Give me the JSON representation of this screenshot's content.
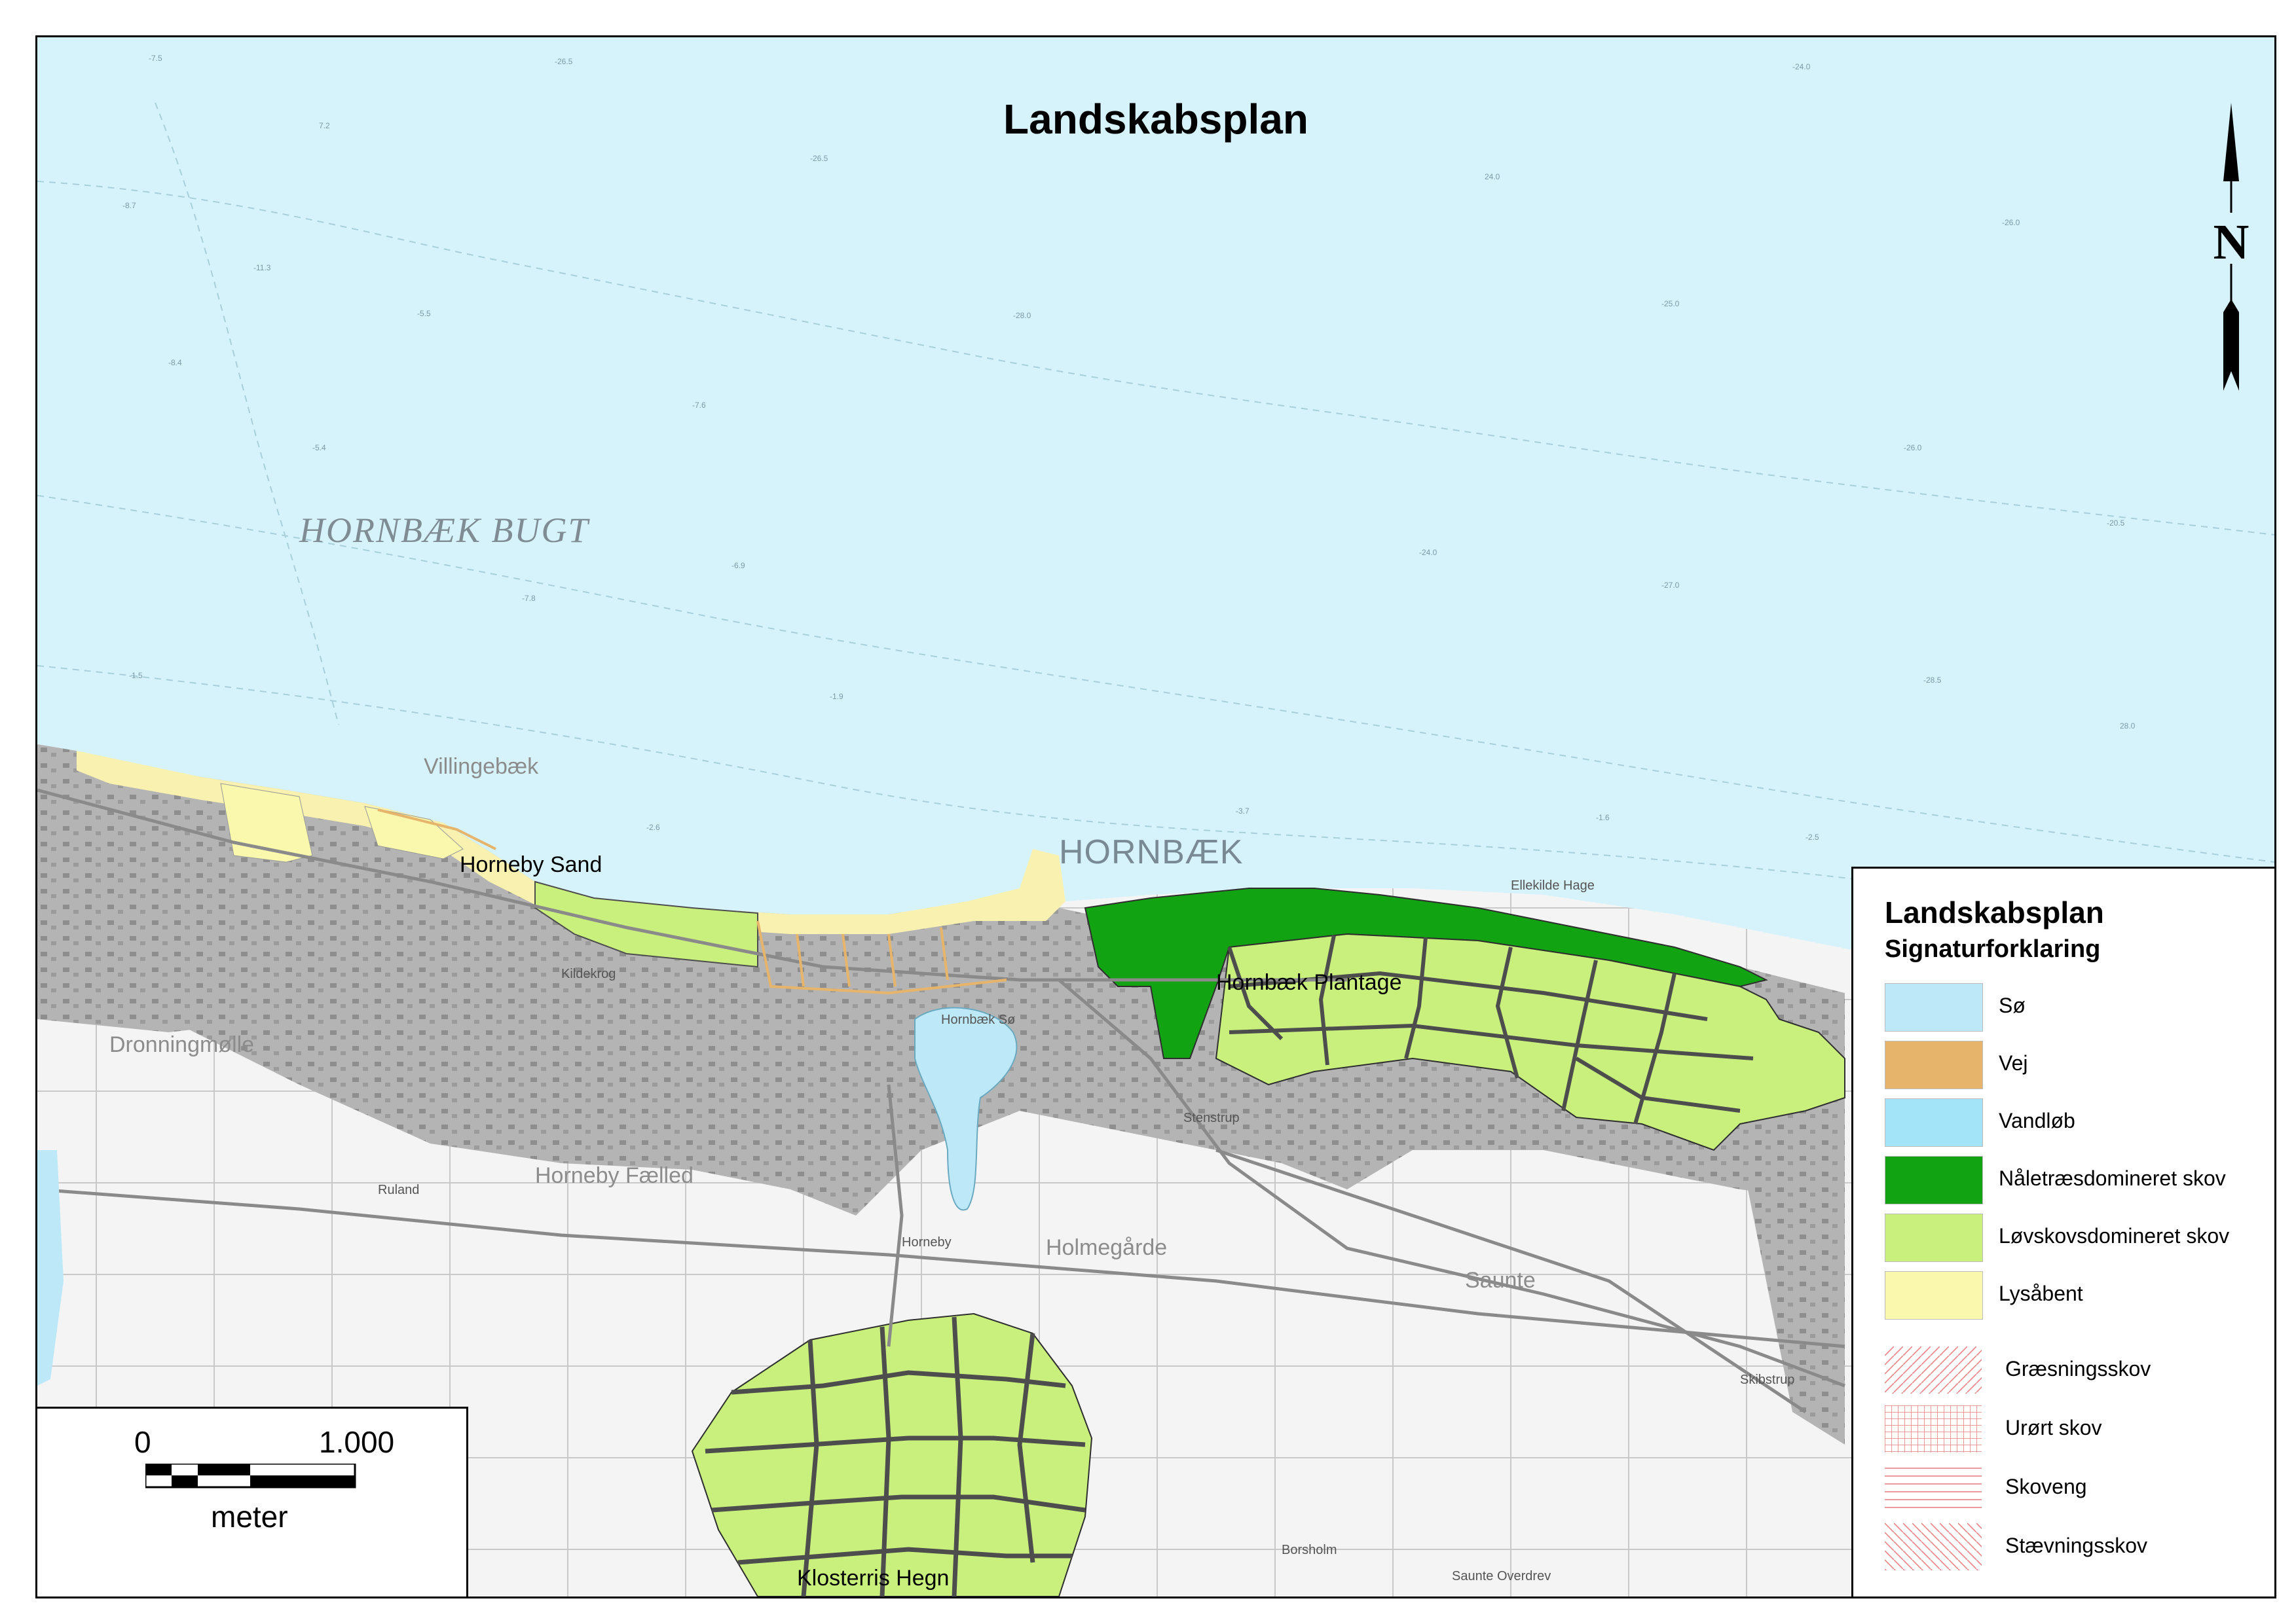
{
  "title": "Landskabsplan",
  "labels": {
    "bay": "HORNBÆK BUGT",
    "town": "HORNBÆK",
    "villingebaek": "Villingebæk",
    "horneby_sand": "Horneby Sand",
    "hornbaek_plantage": "Hornbæk Plantage",
    "dronningmolle": "Dronningmølle",
    "horneby_faelled": "Horneby Fælled",
    "holmegarde": "Holmegårde",
    "saunte": "Saunte",
    "klosterris_hegn": "Klosterris Hegn",
    "saunte_overdrev": "Saunte Overdrev",
    "borsholm": "Borsholm",
    "horneby": "Horneby",
    "kildekrog": "Kildekrog",
    "ruland": "Ruland",
    "skibstrup": "Skibstrup",
    "hornbaek_so": "Hornbæk Sø",
    "stenstrup": "Stenstrup",
    "ellekilde_hage": "Ellekilde Hage"
  },
  "depths": [
    "-7.5",
    "-26.5",
    "-24.0",
    "7.2",
    "-26.5",
    "-8.7",
    "-11.3",
    "24.0",
    "-26.0",
    "-5.5",
    "-8.4",
    "-28.0",
    "-25.0",
    "-7.6",
    "-26.0",
    "-5.4",
    "-27.0",
    "-6.9",
    "-20.5",
    "-7.8",
    "-24.0",
    "-1.5",
    "-1.9",
    "-28.5",
    "28.0",
    "-2.6",
    "-3.7",
    "-1.6",
    "-2.5"
  ],
  "legend": {
    "title": "Landskabsplan",
    "subtitle": "Signaturforklaring",
    "items": [
      {
        "label": "Sø",
        "color": "#bde8f7"
      },
      {
        "label": "Vej",
        "color": "#e6b46a"
      },
      {
        "label": "Vandløb",
        "color": "#a3e4f9"
      },
      {
        "label": "Nåletræsdomineret skov",
        "color": "#11a311"
      },
      {
        "label": "Løvskovsdomineret skov",
        "color": "#c9f07c"
      },
      {
        "label": "Lysåbent",
        "color": "#f9f8ad"
      }
    ],
    "patterns": [
      {
        "label": "Græsningsskov",
        "pattern": "diagonal-right"
      },
      {
        "label": "Urørt skov",
        "pattern": "grid"
      },
      {
        "label": "Skoveng",
        "pattern": "horizontal"
      },
      {
        "label": "Stævningsskov",
        "pattern": "diagonal-left"
      }
    ]
  },
  "scalebar": {
    "start": "0",
    "end": "1.000",
    "unit": "meter"
  },
  "north_arrow": {
    "label": "N"
  },
  "colors": {
    "sea": "#d6f3fb",
    "urban": "#b4b4b4",
    "open_land": "#f4f4f4",
    "sand": "#f9f1b0",
    "conifer": "#11a311",
    "deciduous": "#c9f07c",
    "road": "#e6b46a",
    "compartment_line": "#4d4d4d"
  }
}
